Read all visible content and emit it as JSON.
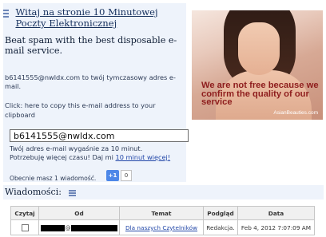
{
  "header": {
    "title": "Witaj na stronie 10 Minutowej Poczty Elektronicznej",
    "tagline": "Beat spam with the best disposable e-mail service."
  },
  "info": {
    "address_text": "b6141555@nwldx.com to twój tymczasowy adres e-mail.",
    "copy_link": "Click: here to copy this e-mail address to your clipboard"
  },
  "ad": {
    "headline": "We are not free because we confirm the quality of our service",
    "brand": "AsianBeauties.com"
  },
  "email": {
    "value": "b6141555@nwldx.com"
  },
  "expiry": {
    "text": "Twój adres e-mail wygaśnie za 10 minut.",
    "more_prefix": "Potrzebuję więcej czasu! Daj mi",
    "more_link": "10 minut więcej!"
  },
  "messages": {
    "count_text": "Obecnie masz 1 wiadomość.",
    "plus_label": "+1",
    "plus_count": "0",
    "section_title": "Wiadomości:",
    "columns": [
      "Czytaj",
      "Od",
      "Temat",
      "Podgląd",
      "Data"
    ],
    "rows": [
      {
        "from_at": "@",
        "subject": "Dla naszych Czytelników",
        "preview": "Redakcja.",
        "date": "Feb 4, 2012 7:07:09 AM"
      }
    ]
  }
}
